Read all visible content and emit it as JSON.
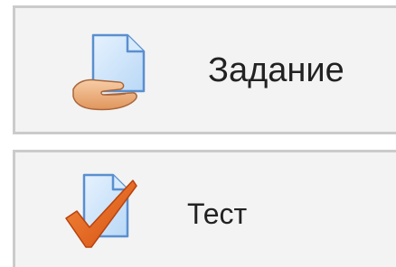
{
  "activities": [
    {
      "label": "Задание",
      "icon": "assignment-hand-document-icon"
    },
    {
      "label": "Тест",
      "icon": "quiz-checkmark-document-icon"
    }
  ],
  "colors": {
    "card_background": "#f3f3f3",
    "card_border": "#cbcbcb",
    "document_fill": "#cfe6fb",
    "document_stroke": "#5a8fcf",
    "hand_fill": "#f2b98a",
    "checkmark": "#e8641e"
  }
}
